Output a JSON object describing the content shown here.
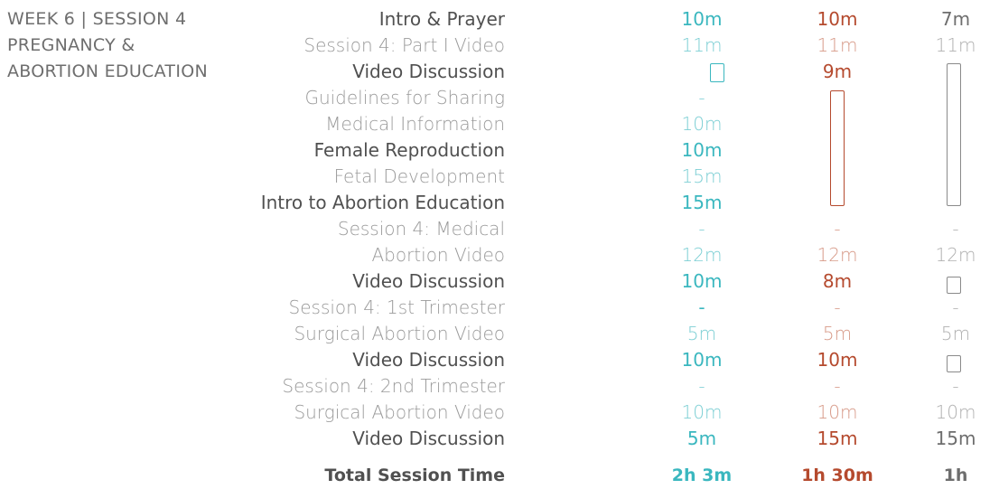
{
  "header": {
    "line1": "WEEK 6  |  SESSION 4",
    "line2": "PREGNANCY &",
    "line3": "ABORTION EDUCATION"
  },
  "rows": [
    {
      "label": "Intro & Prayer",
      "c1": "10m",
      "c2": "10m",
      "c3": "7m"
    },
    {
      "label": "Session 4: Part I Video",
      "c1": "11m",
      "c2": "11m",
      "c3": "11m"
    },
    {
      "label": "Video Discussion",
      "c1": "",
      "c2": "9m",
      "c3": ""
    },
    {
      "label": "Guidelines for Sharing",
      "c1": "-",
      "c2": "",
      "c3": ""
    },
    {
      "label": "Medical Information",
      "c1": "10m",
      "c2": "",
      "c3": ""
    },
    {
      "label": "Female Reproduction",
      "c1": "10m",
      "c2": "",
      "c3": ""
    },
    {
      "label": "Fetal Development",
      "c1": "15m",
      "c2": "",
      "c3": ""
    },
    {
      "label": "Intro to Abortion Education",
      "c1": "15m",
      "c2": "",
      "c3": ""
    },
    {
      "label": "Session 4: Medical",
      "c1": "-",
      "c2": "-",
      "c3": "-"
    },
    {
      "label": "Abortion Video",
      "c1": "12m",
      "c2": "12m",
      "c3": "12m"
    },
    {
      "label": "Video Discussion",
      "c1": "10m",
      "c2": "8m",
      "c3": ""
    },
    {
      "label": "Session 4: 1st Trimester",
      "c1": "-",
      "c2": "-",
      "c3": "-"
    },
    {
      "label": "Surgical Abortion Video",
      "c1": "5m",
      "c2": "5m",
      "c3": "5m"
    },
    {
      "label": "Video Discussion",
      "c1": "10m",
      "c2": "10m",
      "c3": ""
    },
    {
      "label": "Session 4: 2nd Trimester",
      "c1": "-",
      "c2": "-",
      "c3": "-"
    },
    {
      "label": "Surgical Abortion Video",
      "c1": "10m",
      "c2": "10m",
      "c3": "10m"
    },
    {
      "label": "Video Discussion",
      "c1": "5m",
      "c2": "15m",
      "c3": "15m"
    }
  ],
  "total": {
    "label": "Total Session Time",
    "c1": "2h 3m",
    "c2": "1h 30m",
    "c3": "1h"
  },
  "colors": {
    "teal": "#3ab7bf",
    "red": "#b54a2e",
    "gray": "#6e6e6e"
  }
}
